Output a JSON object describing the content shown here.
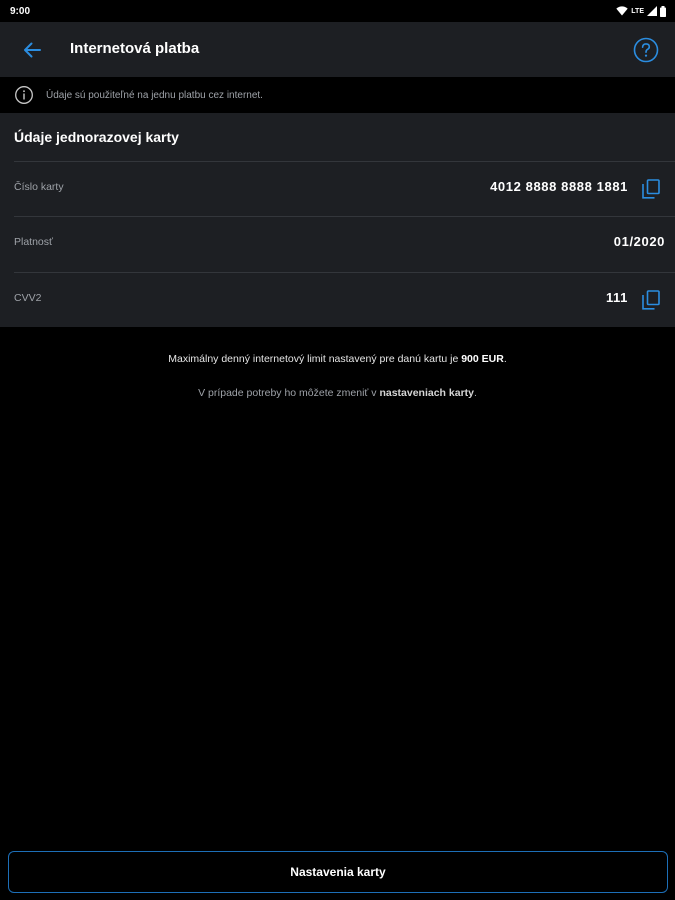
{
  "status_bar": {
    "time": "9:00",
    "network": "LTE"
  },
  "app_bar": {
    "title": "Internetová platba"
  },
  "info": {
    "text": "Údaje sú použiteľné na jednu platbu cez internet."
  },
  "card_panel": {
    "heading": "Údaje jednorazovej karty",
    "rows": [
      {
        "label": "Číslo karty",
        "value": "4012 8888 8888 1881"
      },
      {
        "label": "Platnosť",
        "value": "01/2020"
      },
      {
        "label": "CVV2",
        "value": "111"
      }
    ]
  },
  "limit": {
    "prefix": "Maximálny denný internetový limit nastavený pre danú kartu je ",
    "amount": "900 EUR",
    "suffix": "."
  },
  "change": {
    "prefix": "V prípade potreby ho môžete zmeniť v ",
    "link": "nastaveniach karty",
    "suffix": "."
  },
  "settings_button": {
    "label": "Nastavenia karty"
  },
  "colors": {
    "accent": "#1d6fb8",
    "panel": "#1d1f23",
    "background": "#000000",
    "muted": "#9ea2a8"
  }
}
